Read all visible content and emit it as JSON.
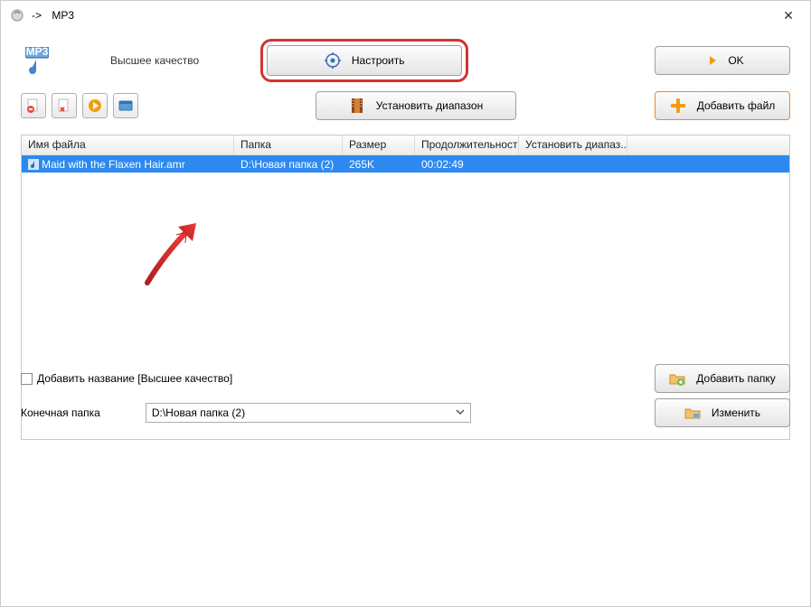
{
  "window": {
    "title_prefix": "->",
    "title": "MP3",
    "close": "✕"
  },
  "row1": {
    "quality_label": "Высшее качество",
    "settings_label": "Настроить",
    "ok_label": "OK"
  },
  "row2": {
    "range_label": "Установить диапазон",
    "add_file_label": "Добавить файл"
  },
  "table": {
    "headers": {
      "filename": "Имя файла",
      "folder": "Папка",
      "size": "Размер",
      "duration": "Продолжительность",
      "range": "Установить диапаз..."
    },
    "rows": [
      {
        "filename": "Maid with the Flaxen Hair.amr",
        "folder": "D:\\Новая папка (2)",
        "size": "265K",
        "duration": "00:02:49",
        "range": ""
      }
    ]
  },
  "bottom": {
    "add_title_label": "Добавить название [Высшее качество]",
    "add_folder_label": "Добавить папку",
    "dest_label": "Конечная папка",
    "dest_value": "D:\\Новая папка (2)",
    "change_label": "Изменить"
  }
}
